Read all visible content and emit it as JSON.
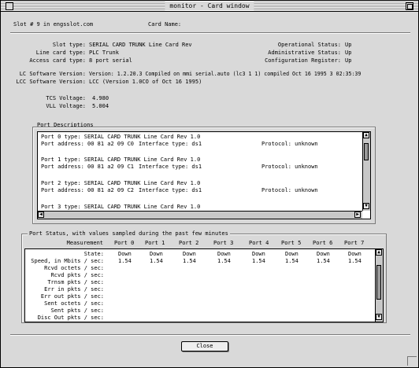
{
  "window": {
    "title": "monitor - Card window"
  },
  "header": {
    "slot": "Slot # 9 in engsslot.com",
    "card_name": "Card Name:"
  },
  "info_left": [
    {
      "label": "Slot type:",
      "value": "SERIAL CARD TRUNK Line Card Rev"
    },
    {
      "label": "Line card type:",
      "value": "PLC Trunk"
    },
    {
      "label": "Access card type:",
      "value": "8 port serial"
    }
  ],
  "info_right": [
    {
      "label": "Operational Status:",
      "value": "Up"
    },
    {
      "label": "Administrative Status:",
      "value": "Up"
    },
    {
      "label": "Configuration Register:",
      "value": "Up"
    }
  ],
  "software": [
    {
      "label": "LC Software Version:",
      "value": "Version: 1.2.20.3 Compiled on mmi serial.auto (lc3 1 1) compiled Oct 16 1995 3 02:35:39"
    },
    {
      "label": "LCC Software Version:",
      "value": "LCC (Version 1.0CO of Oct 16 1995)"
    }
  ],
  "voltages": [
    {
      "label": "TCS Voltage:",
      "value": "4.980"
    },
    {
      "label": "VLL Voltage:",
      "value": "5.004"
    }
  ],
  "port_desc": {
    "title": "Port Descriptions",
    "ports": [
      {
        "type": "Port 0 type: SERIAL CARD TRUNK Line Card Rev 1.0",
        "address": "Port address: 00 81 a2 09 C0",
        "iface": "Interface type: ds1",
        "protocol": "Protocol: unknown"
      },
      {
        "type": "Port 1 type: SERIAL CARD TRUNK Line Card Rev 1.0",
        "address": "Port address: 00 81 a2 09 C1",
        "iface": "Interface type: ds1",
        "protocol": "Protocol: unknown"
      },
      {
        "type": "Port 2 type: SERIAL CARD TRUNK Line Card Rev 1.0",
        "address": "Port address: 00 81 a2 09 C2",
        "iface": "Interface type: ds1",
        "protocol": "Protocol: unknown"
      },
      {
        "type": "Port 3 type: SERIAL CARD TRUNK Line Card Rev 1.0",
        "address": "",
        "iface": "",
        "protocol": ""
      }
    ]
  },
  "port_status": {
    "title": "Port Status, with values sampled during the past few minutes",
    "header_label": "Measurement",
    "ports": [
      "Port 0",
      "Port 1",
      "Port 2",
      "Port 3",
      "Port 4",
      "Port 5",
      "Port 6",
      "Port 7"
    ],
    "rows": [
      {
        "label": "State:",
        "values": [
          "Down",
          "Down",
          "Down",
          "Down",
          "Down",
          "Down",
          "Down",
          "Down"
        ]
      },
      {
        "label": "Speed, in Mbits / sec:",
        "values": [
          "1.54",
          "1.54",
          "1.54",
          "1.54",
          "1.54",
          "1.54",
          "1.54",
          "1.54"
        ]
      },
      {
        "label": "Rcvd octets / sec:",
        "values": [
          "",
          "",
          "",
          "",
          "",
          "",
          "",
          ""
        ]
      },
      {
        "label": "Rcvd pkts / sec:",
        "values": [
          "",
          "",
          "",
          "",
          "",
          "",
          "",
          ""
        ]
      },
      {
        "label": "Trnsm pkts / sec:",
        "values": [
          "",
          "",
          "",
          "",
          "",
          "",
          "",
          ""
        ]
      },
      {
        "label": "Err in pkts / sec:",
        "values": [
          "",
          "",
          "",
          "",
          "",
          "",
          "",
          ""
        ]
      },
      {
        "label": "Err out pkts / sec:",
        "values": [
          "",
          "",
          "",
          "",
          "",
          "",
          "",
          ""
        ]
      },
      {
        "label": "Sent octets / sec:",
        "values": [
          "",
          "",
          "",
          "",
          "",
          "",
          "",
          ""
        ]
      },
      {
        "label": "Sent pkts / sec:",
        "values": [
          "",
          "",
          "",
          "",
          "",
          "",
          "",
          ""
        ]
      },
      {
        "label": "Disc Out pkts / sec:",
        "values": [
          "",
          "",
          "",
          "",
          "",
          "",
          "",
          ""
        ]
      }
    ]
  },
  "buttons": {
    "close": "Close"
  }
}
